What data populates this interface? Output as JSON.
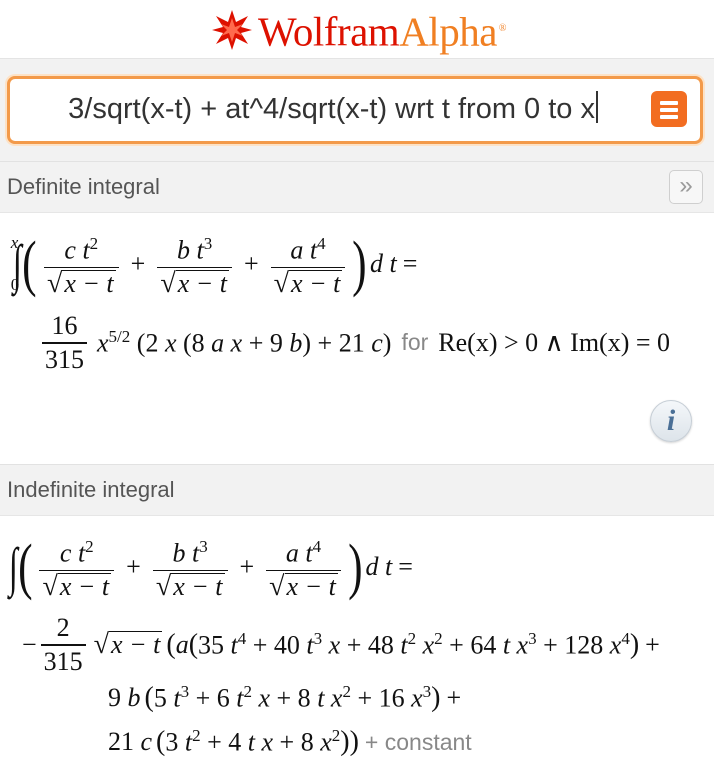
{
  "header": {
    "logo_wolfram": "Wolfram",
    "logo_alpha": "Alpha",
    "tm": "®"
  },
  "search": {
    "query": "3/sqrt(x-t) + at^4/sqrt(x-t) wrt t from 0 to x"
  },
  "pods": [
    {
      "title": "Definite integral",
      "condition_word": "for",
      "condition": "Re(x) > 0 ∧ Im(x) = 0",
      "expand_label": "»",
      "info_label": "i"
    },
    {
      "title": "Indefinite integral",
      "constant": "+ constant"
    }
  ],
  "colors": {
    "accent": "#f26d21",
    "logo_red": "#dd1100",
    "logo_orange": "#f07f22",
    "pod_bg": "#f2f2f2"
  }
}
